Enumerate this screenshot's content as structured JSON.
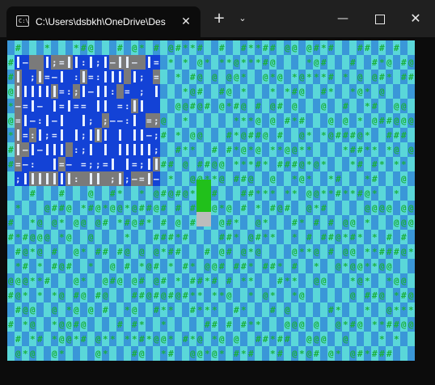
{
  "window": {
    "tab_icon_glyph": "C:\\",
    "tab_title": "C:\\Users\\dsbkh\\OneDrive\\Des",
    "tab_close": "✕",
    "new_tab": "+",
    "dropdown": "⌄",
    "minimize": "—",
    "close": "✕"
  },
  "colors": {
    "cyan": "#5ad7d9",
    "blue": "#3a97d8",
    "text_green": "#1bb03e",
    "deep_blue": "#1342d6",
    "gray": "#7a7a7a",
    "white_bar": "#e8f0ff",
    "player_green": "#21c01b",
    "player_gray": "#bcbcbc"
  },
  "icons": {
    "tab_icon": "terminal-icon",
    "new_tab": "plus-icon",
    "dropdown": "chevron-down-icon",
    "minimize": "minimize-icon",
    "maximize": "maximize-icon",
    "close": "close-icon"
  },
  "game": {
    "terrain_symbols": [
      "@",
      "#",
      "*"
    ],
    "building_symbols": [
      ":",
      ";",
      "=",
      "—"
    ]
  }
}
